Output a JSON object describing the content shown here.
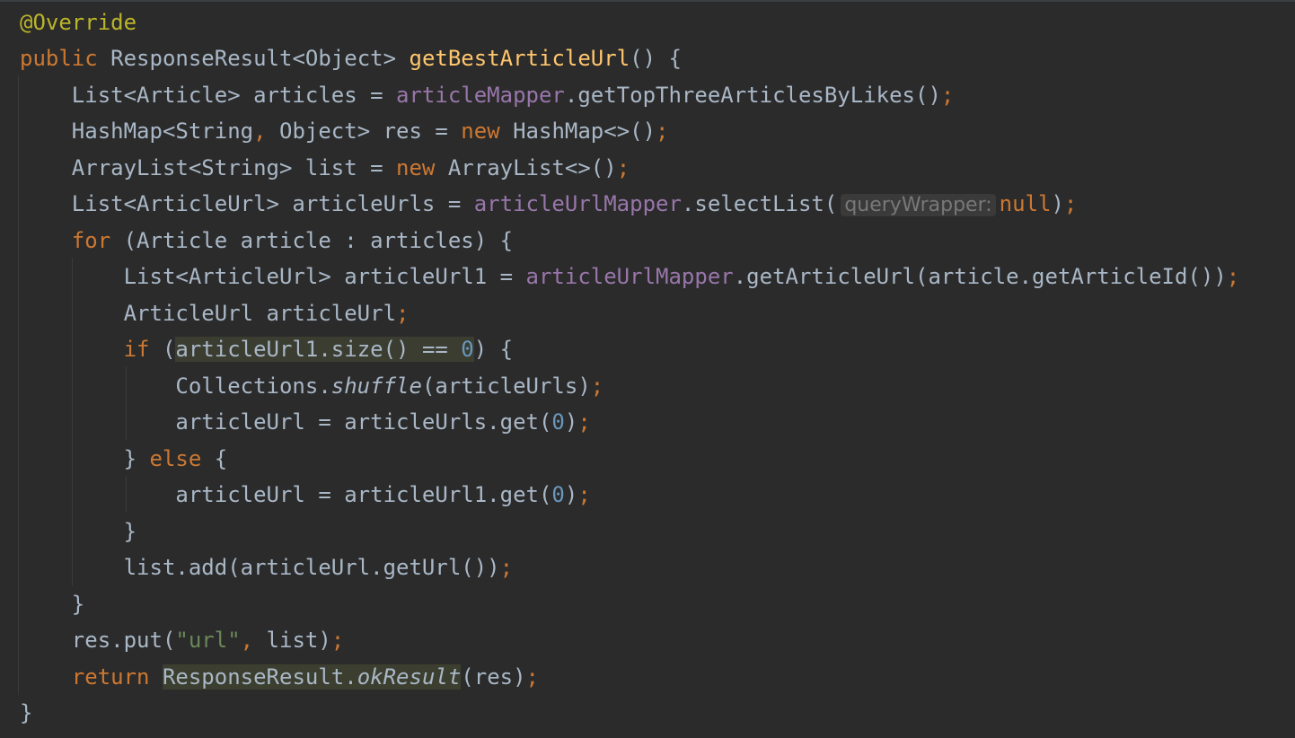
{
  "code": {
    "l1": {
      "annotation": "@Override"
    },
    "l2": {
      "kw": "public",
      "type": "ResponseResult<Object>",
      "name": "getBestArticleUrl",
      "rest": "() {"
    },
    "l3": {
      "decl": "List<Article> articles = ",
      "field": "articleMapper",
      "call": ".getTopThreeArticlesByLikes()",
      "semi": ";"
    },
    "l4": {
      "decl1": "HashMap<String",
      "comma": ",",
      "decl2": " Object> res = ",
      "kw": "new",
      "rest": " HashMap<>()",
      "semi": ";"
    },
    "l5": {
      "decl": "ArrayList<String> list = ",
      "kw": "new",
      "rest": " ArrayList<>()",
      "semi": ";"
    },
    "l6": {
      "decl": "List<ArticleUrl> articleUrls = ",
      "field": "articleUrlMapper",
      "call": ".selectList(",
      "hint": "queryWrapper:",
      "kw": "null",
      "close": ")",
      "semi": ";"
    },
    "l7": {
      "kw": "for",
      "rest": " (Article article : articles) {"
    },
    "l8": {
      "decl": "List<ArticleUrl> articleUrl1 = ",
      "field": "articleUrlMapper",
      "call": ".getArticleUrl(article.getArticleId())",
      "semi": ";"
    },
    "l9": {
      "decl": "ArticleUrl articleUrl",
      "semi": ";"
    },
    "l10": {
      "kw": "if",
      "open": " (",
      "cond": "articleUrl1.size() == ",
      "num": "0",
      "close": ") {"
    },
    "l11": {
      "cls": "Collections.",
      "method": "shuffle",
      "args": "(articleUrls)",
      "semi": ";"
    },
    "l12": {
      "lhs": "articleUrl = articleUrls.get(",
      "num": "0",
      "close": ")",
      "semi": ";"
    },
    "l13": {
      "brace": "} ",
      "kw": "else",
      "rest": " {"
    },
    "l14": {
      "lhs": "articleUrl = articleUrl1.get(",
      "num": "0",
      "close": ")",
      "semi": ";"
    },
    "l15": {
      "brace": "}"
    },
    "l16": {
      "stmt": "list.add(articleUrl.getUrl())",
      "semi": ";"
    },
    "l17": {
      "brace": "}"
    },
    "l18": {
      "pre": "res.put(",
      "str": "\"url\"",
      "comma": ",",
      "post": " list)",
      "semi": ";"
    },
    "l19": {
      "kw": "return",
      "cls": "ResponseResult.",
      "method": "okResult",
      "rest": "(res)",
      "semi": ";"
    },
    "l20": {
      "brace": "}"
    }
  }
}
